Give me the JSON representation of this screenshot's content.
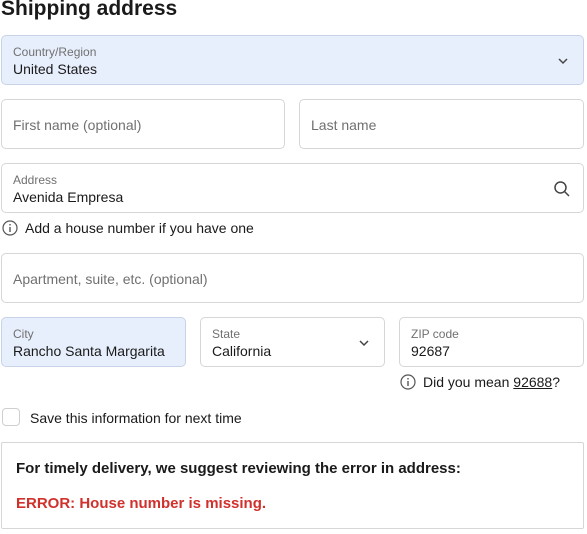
{
  "header": {
    "title": "Shipping address"
  },
  "country": {
    "label": "Country/Region",
    "value": "United States"
  },
  "first_name": {
    "placeholder": "First name (optional)"
  },
  "last_name": {
    "placeholder": "Last name"
  },
  "address": {
    "label": "Address",
    "value": "Avenida Empresa"
  },
  "address_hint": {
    "text": "Add a house number if you have one"
  },
  "apartment": {
    "placeholder": "Apartment, suite, etc. (optional)"
  },
  "city": {
    "label": "City",
    "value": "Rancho Santa Margarita"
  },
  "state": {
    "label": "State",
    "value": "California"
  },
  "zip": {
    "label": "ZIP code",
    "value": "92687"
  },
  "zip_hint": {
    "prefix": "Did you mean ",
    "suggestion": "92688",
    "suffix": "?"
  },
  "save_info": {
    "label": "Save this information for next time",
    "checked": false
  },
  "notice": {
    "title": "For timely delivery, we suggest reviewing the error in address:",
    "error": "ERROR: House number is missing."
  },
  "colors": {
    "selected_field_bg": "#e8effc",
    "error": "#d0312d",
    "border": "#d6d6d6"
  },
  "icons": [
    "chevron-down-icon",
    "search-icon",
    "info-icon"
  ]
}
